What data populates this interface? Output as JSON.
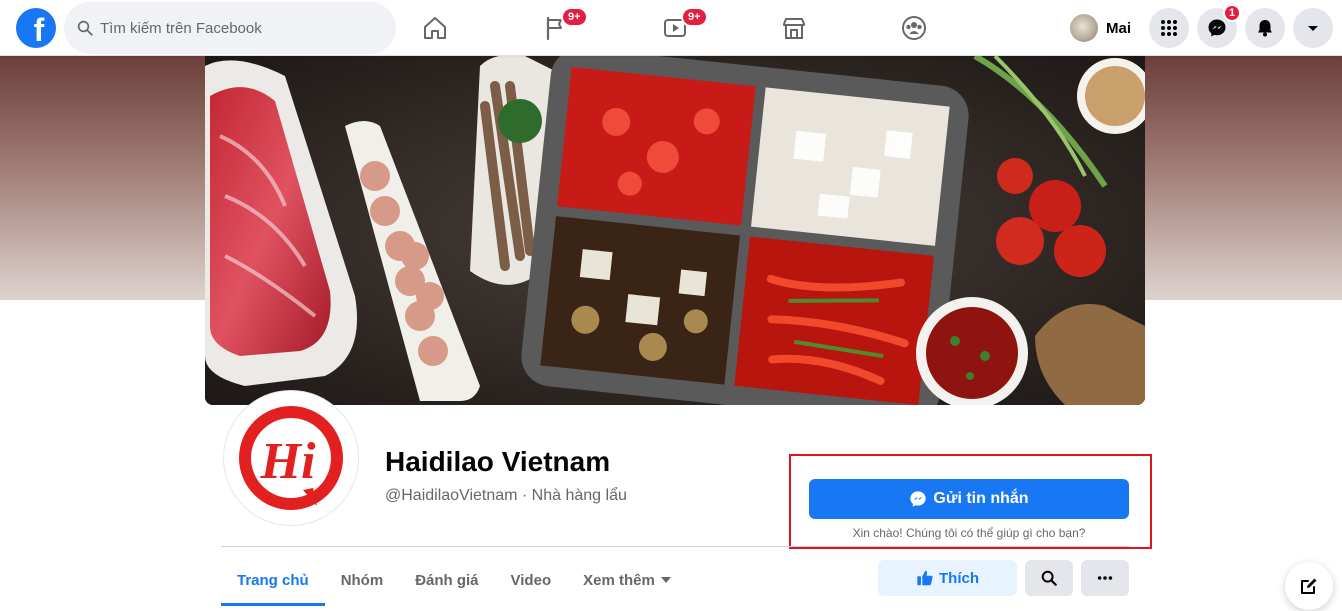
{
  "topbar": {
    "search_placeholder": "Tìm kiếm trên Facebook",
    "nav": [
      {
        "name": "home-icon",
        "badge": ""
      },
      {
        "name": "pages-flag-icon",
        "badge": "9+"
      },
      {
        "name": "watch-video-icon",
        "badge": "9+"
      },
      {
        "name": "marketplace-store-icon",
        "badge": ""
      },
      {
        "name": "groups-icon",
        "badge": ""
      }
    ],
    "user_name": "Mai",
    "messenger_badge": "1"
  },
  "page": {
    "name": "Haidilao Vietnam",
    "subtitle": "@HaidilaoVietnam · Nhà hàng lẩu",
    "message_button": "Gửi tin nhắn",
    "greeting": "Xin chào! Chúng tôi có thể giúp gì cho bạn?",
    "logo_text": "Hi"
  },
  "tabs": [
    {
      "label": "Trang chủ",
      "active": true
    },
    {
      "label": "Nhóm"
    },
    {
      "label": "Đánh giá"
    },
    {
      "label": "Video"
    },
    {
      "label": "Xem thêm"
    }
  ],
  "actions": {
    "like_label": "Thích"
  },
  "colors": {
    "brand_blue": "#1877f2",
    "badge_red": "#e41e3f",
    "highlight_box": "#e0141e",
    "haidilao_red": "#e2201f"
  }
}
